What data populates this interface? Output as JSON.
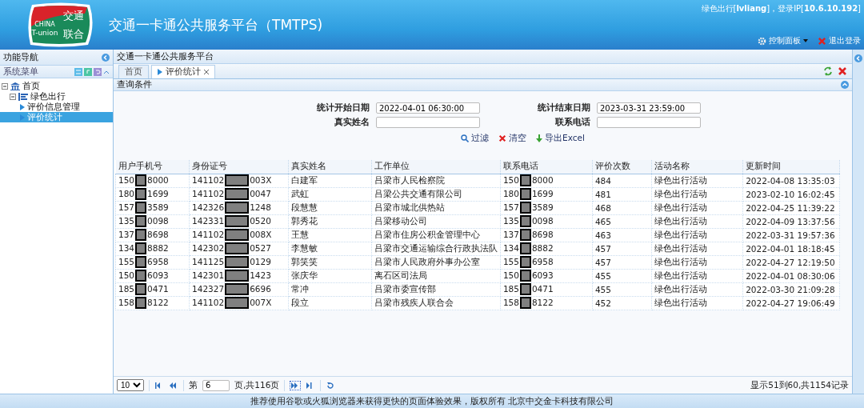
{
  "header": {
    "logo_top": "交通",
    "logo_bottom": "联合",
    "logo_small_1": "CHINA",
    "logo_small_2": "T-union",
    "title": "交通一卡通公共服务平台（TMTPS)",
    "user_info": "绿色出行[**lvliang**]，登录IP[**10.6.10.192**]",
    "control_panel": "控制面板",
    "logout": "退出登录"
  },
  "sidebar": {
    "title": "功能导航",
    "menu_title": "系统菜单",
    "tree": [
      {
        "label": "首页",
        "kind": "home",
        "expanded": true,
        "selected": false,
        "children": [
          {
            "label": "绿色出行",
            "kind": "folder",
            "expanded": true,
            "selected": false,
            "children": [
              {
                "label": "评价信息管理",
                "kind": "page",
                "selected": false
              },
              {
                "label": "评价统计",
                "kind": "page",
                "selected": true
              }
            ]
          }
        ]
      }
    ]
  },
  "breadcrumb": "交通一卡通公共服务平台",
  "tabs": [
    {
      "label": "首页",
      "selected": false,
      "closable": false
    },
    {
      "label": "评价统计",
      "selected": true,
      "closable": true
    }
  ],
  "query": {
    "title": "查询条件",
    "fields": [
      {
        "label": "统计开始日期",
        "value": "2022-04-01 06:30:00"
      },
      {
        "label": "统计结束日期",
        "value": "2023-03-31 23:59:00"
      },
      {
        "label": "真实姓名"
      },
      {
        "label": "联系电话"
      }
    ],
    "actions": [
      {
        "label": "过滤",
        "kind": "search"
      },
      {
        "label": "清空",
        "kind": "clear"
      },
      {
        "label": "导出Excel",
        "kind": "export"
      }
    ]
  },
  "table": {
    "columns": [
      "用户手机号",
      "身份证号",
      "真实姓名",
      "工作单位",
      "联系电话",
      "评价次数",
      "活动名称",
      "更新时间"
    ],
    "rows": [
      {
        "phone": [
          "150",
          "8000"
        ],
        "id": [
          "141102",
          "003X"
        ],
        "name": "白建军",
        "unit": "吕梁市人民检察院",
        "contact": [
          "150",
          "8000"
        ],
        "count": "484",
        "activity": "绿色出行活动",
        "time": "2022-04-08 13:35:03"
      },
      {
        "phone": [
          "180",
          "1699"
        ],
        "id": [
          "141102",
          "0047"
        ],
        "name": "武虹",
        "unit": "吕梁公共交通有限公司",
        "contact": [
          "180",
          "1699"
        ],
        "count": "481",
        "activity": "绿色出行活动",
        "time": "2023-02-10 16:02:45"
      },
      {
        "phone": [
          "157",
          "3589"
        ],
        "id": [
          "142326",
          "1248"
        ],
        "name": "段慧慧",
        "unit": "吕梁市城北供热站",
        "contact": [
          "157",
          "3589"
        ],
        "count": "468",
        "activity": "绿色出行活动",
        "time": "2022-04-25 11:39:22"
      },
      {
        "phone": [
          "135",
          "0098"
        ],
        "id": [
          "142331",
          "0520"
        ],
        "name": "郭秀花",
        "unit": "吕梁移动公司",
        "contact": [
          "135",
          "0098"
        ],
        "count": "465",
        "activity": "绿色出行活动",
        "time": "2022-04-09 13:37:56"
      },
      {
        "phone": [
          "137",
          "8698"
        ],
        "id": [
          "141102",
          "008X"
        ],
        "name": "王慧",
        "unit": "吕梁市住房公积金管理中心",
        "contact": [
          "137",
          "8698"
        ],
        "count": "463",
        "activity": "绿色出行活动",
        "time": "2022-03-31 19:57:36"
      },
      {
        "phone": [
          "134",
          "8882"
        ],
        "id": [
          "142302",
          "0527"
        ],
        "name": "李慧敏",
        "unit": "吕梁市交通运输综合行政执法队",
        "contact": [
          "134",
          "8882"
        ],
        "count": "457",
        "activity": "绿色出行活动",
        "time": "2022-04-01 18:18:45"
      },
      {
        "phone": [
          "155",
          "6958"
        ],
        "id": [
          "141125",
          "0129"
        ],
        "name": "郭笑笑",
        "unit": "吕梁市人民政府外事办公室",
        "contact": [
          "155",
          "6958"
        ],
        "count": "457",
        "activity": "绿色出行活动",
        "time": "2022-04-27 12:19:50"
      },
      {
        "phone": [
          "150",
          "6093"
        ],
        "id": [
          "142301",
          "1423"
        ],
        "name": "张庆华",
        "unit": "离石区司法局",
        "contact": [
          "150",
          "6093"
        ],
        "count": "455",
        "activity": "绿色出行活动",
        "time": "2022-04-01 08:30:06"
      },
      {
        "phone": [
          "185",
          "0471"
        ],
        "id": [
          "142327",
          "6696"
        ],
        "name": "常冲",
        "unit": "吕梁市委宣传部",
        "contact": [
          "185",
          "0471"
        ],
        "count": "455",
        "activity": "绿色出行活动",
        "time": "2022-03-30 21:09:28"
      },
      {
        "phone": [
          "158",
          "8122"
        ],
        "id": [
          "141102",
          "007X"
        ],
        "name": "段立",
        "unit": "吕梁市残疾人联合会",
        "contact": [
          "158",
          "8122"
        ],
        "count": "452",
        "activity": "绿色出行活动",
        "time": "2022-04-27 19:06:49"
      }
    ]
  },
  "pager": {
    "page_size": "10",
    "page_label": "第",
    "page": "6",
    "total_pages": "页,共116页",
    "summary": "显示51到60,共1154记录"
  },
  "footer": "推荐使用谷歌或火狐浏览器来获得更快的页面体验效果，版权所有 北京中交金卡科技有限公司"
}
